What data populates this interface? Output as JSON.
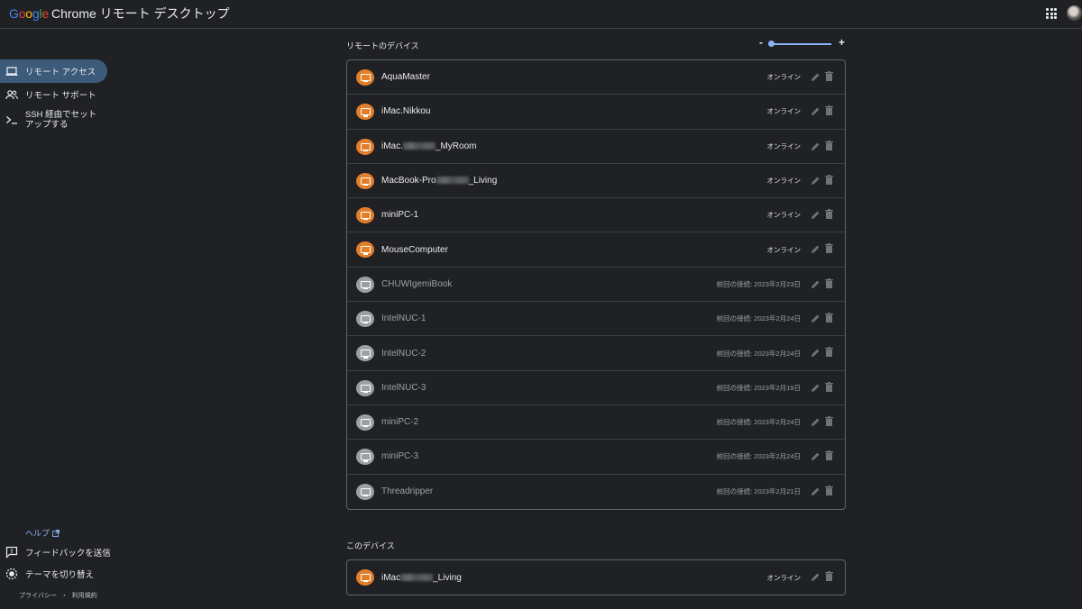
{
  "header": {
    "brand_google": "Google",
    "brand_rest": "Chrome リモート デスクトップ"
  },
  "sidebar": {
    "items": [
      {
        "label": "リモート アクセス",
        "icon": "laptop-icon",
        "active": true
      },
      {
        "label": "リモート サポート",
        "icon": "people-icon",
        "active": false
      },
      {
        "label": "SSH 経由でセットアップする",
        "icon": "terminal-icon",
        "active": false
      }
    ],
    "help_label": "ヘルプ",
    "feedback_label": "フィードバックを送信",
    "theme_label": "テーマを切り替え",
    "privacy_label": "プライバシー",
    "separator": "・",
    "terms_label": "利用規約"
  },
  "remote_section": {
    "title": "リモートのデバイス",
    "zoom_minus": "-",
    "zoom_plus": "+",
    "zoom_level": 0.03,
    "devices": [
      {
        "name": "AquaMaster",
        "status": "オンライン",
        "online": true
      },
      {
        "name": "iMac.Nikkou",
        "status": "オンライン",
        "online": true
      },
      {
        "name_prefix": "iMac.",
        "name_suffix": "_MyRoom",
        "status": "オンライン",
        "online": true
      },
      {
        "name_prefix": "MacBook-Pro",
        "name_suffix": "_Living",
        "status": "オンライン",
        "online": true
      },
      {
        "name": "miniPC-1",
        "status": "オンライン",
        "online": true
      },
      {
        "name": "MouseComputer",
        "status": "オンライン",
        "online": true
      },
      {
        "name": "CHUWIgemiBook",
        "status": "前回の接続: 2023年2月23日",
        "online": false
      },
      {
        "name": "IntelNUC-1",
        "status": "前回の接続: 2023年2月24日",
        "online": false
      },
      {
        "name": "IntelNUC-2",
        "status": "前回の接続: 2023年2月24日",
        "online": false
      },
      {
        "name": "IntelNUC-3",
        "status": "前回の接続: 2023年2月19日",
        "online": false
      },
      {
        "name": "miniPC-2",
        "status": "前回の接続: 2023年2月24日",
        "online": false
      },
      {
        "name": "miniPC-3",
        "status": "前回の接続: 2023年2月24日",
        "online": false
      },
      {
        "name": "Threadripper",
        "status": "前回の接続: 2023年2月21日",
        "online": false
      }
    ]
  },
  "this_device_section": {
    "title": "このデバイス",
    "device": {
      "name_prefix": "iMac",
      "name_suffix": "_Living",
      "status": "オンライン",
      "online": true
    }
  },
  "colors": {
    "background": "#202124",
    "online_icon": "#e37f2a",
    "offline_icon": "#9aa0a6",
    "accent": "#8ab4f8",
    "active_nav": "#3c5a7a"
  }
}
